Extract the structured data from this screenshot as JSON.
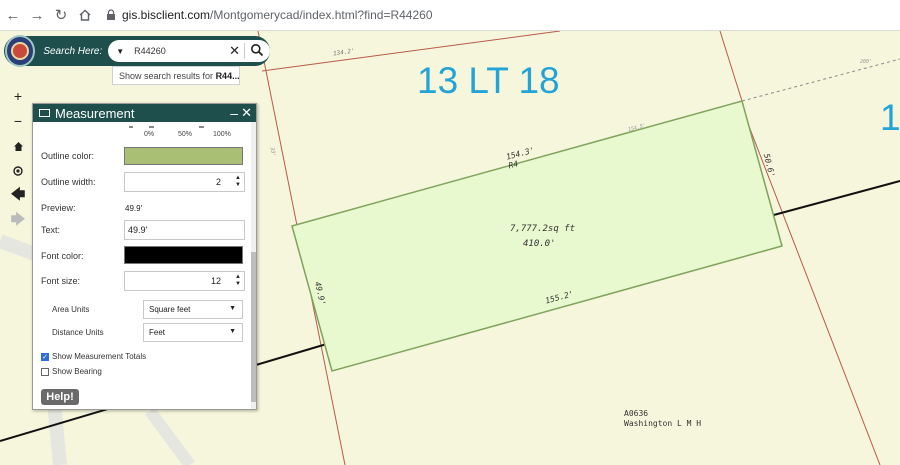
{
  "browser": {
    "back_icon": "arrow-left-icon",
    "forward_icon": "arrow-right-icon",
    "reload_icon": "reload-icon",
    "home_icon": "home-icon",
    "url_host": "gis.bisclient.com",
    "url_path": "/Montgomerycad/index.html?find=R44260"
  },
  "search": {
    "label": "Search Here:",
    "value": "R44260",
    "suggestion_prefix": "Show search results for",
    "suggestion_term": "R44..."
  },
  "map": {
    "lot_label_main": "13 LT 18",
    "lot_label_edge": "1",
    "area_label": "7,777.2sq ft",
    "perimeter_label": "410.0'",
    "top_edge": "154.3'",
    "top_edge_suffix": "R4",
    "bottom_edge": "155.2'",
    "left_edge": "49.9'",
    "right_edge": "50.6'",
    "tiny_top": "154.5'",
    "tiny_far": "200'",
    "tiny_upper": "134.2'",
    "tiny_left": "33'",
    "abstract_code": "A0636",
    "abstract_name": "Washington L M H"
  },
  "panel": {
    "title": "Measurement",
    "pct_0": "0%",
    "pct_50": "50%",
    "pct_100": "100%",
    "outline_color_label": "Outline color:",
    "outline_color": "#a8bf74",
    "outline_width_label": "Outline width:",
    "outline_width": "2",
    "preview_label": "Preview:",
    "preview_value": "49.9'",
    "text_label": "Text:",
    "text_value": "49.9'",
    "font_color_label": "Font color:",
    "font_color": "#000000",
    "font_size_label": "Font size:",
    "font_size": "12",
    "area_units_label": "Area Units",
    "area_units_value": "Square feet",
    "distance_units_label": "Distance Units",
    "distance_units_value": "Feet",
    "show_totals_label": "Show Measurement Totals",
    "show_bearing_label": "Show Bearing",
    "help_label": "Help!"
  },
  "colors": {
    "header_teal": "#1e4f4c",
    "map_background": "#f6f6dc",
    "parcel_fill": "#e8f9cf",
    "parcel_line": "#b85a4a",
    "lot_label": "#23a3d6"
  }
}
